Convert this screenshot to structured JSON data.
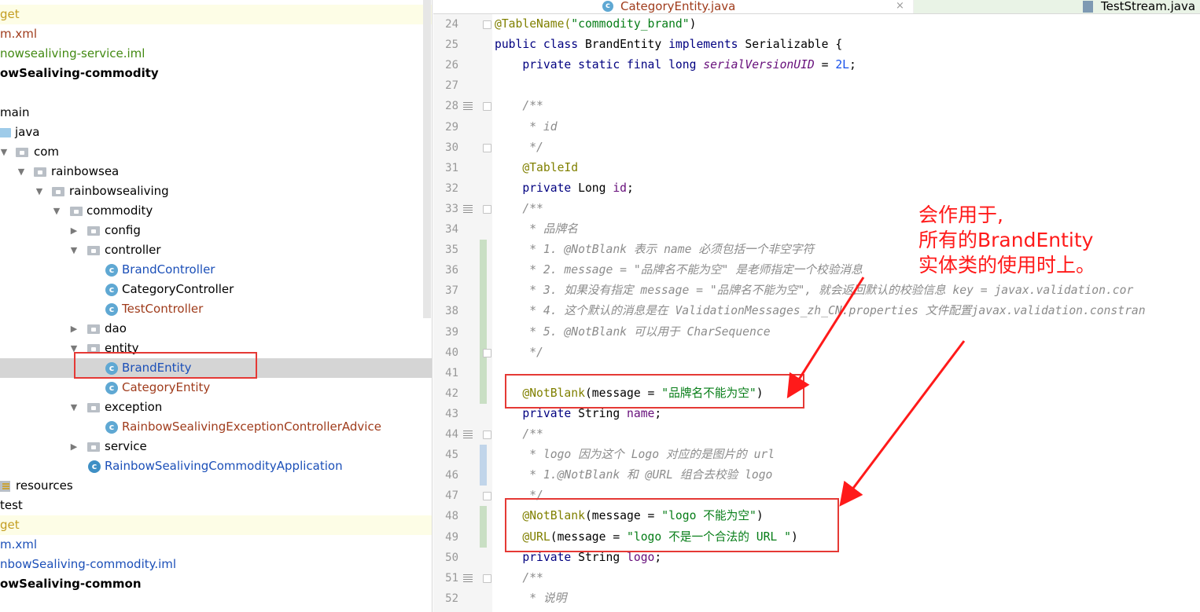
{
  "tree": {
    "rows": [
      {
        "label": "get",
        "color": "#c39d21",
        "bg": "yellow"
      },
      {
        "label": "m.xml",
        "color": "#9f3b1b"
      },
      {
        "label": "nowsealiving-service.iml",
        "color": "#438a13"
      },
      {
        "label": "owSealiving-commodity",
        "color": "#000000",
        "bold": true
      },
      {
        "label": "",
        "color": "#000000"
      },
      {
        "label": "main",
        "color": "#000000"
      },
      {
        "label": "java",
        "color": "#000000"
      },
      {
        "label": "com",
        "color": "#000000"
      },
      {
        "label": "rainbowsea",
        "color": "#000000"
      },
      {
        "label": "rainbowsealiving",
        "color": "#000000"
      },
      {
        "label": "commodity",
        "color": "#000000"
      },
      {
        "label": "config",
        "color": "#000000"
      },
      {
        "label": "controller",
        "color": "#000000"
      },
      {
        "label": "BrandController",
        "color": "#1b4fb8"
      },
      {
        "label": "CategoryController",
        "color": "#000000"
      },
      {
        "label": "TestController",
        "color": "#9f3b1b"
      },
      {
        "label": "dao",
        "color": "#000000"
      },
      {
        "label": "entity",
        "color": "#000000"
      },
      {
        "label": "BrandEntity",
        "color": "#1b4fb8",
        "bg": "sel"
      },
      {
        "label": "CategoryEntity",
        "color": "#9f3b1b"
      },
      {
        "label": "exception",
        "color": "#000000"
      },
      {
        "label": "RainbowSealivingExceptionControllerAdvice",
        "color": "#9f3b1b"
      },
      {
        "label": "service",
        "color": "#000000"
      },
      {
        "label": "RainbowSealivingCommodityApplication",
        "color": "#1b4fb8"
      },
      {
        "label": "resources",
        "color": "#000000"
      },
      {
        "label": "test",
        "color": "#000000"
      },
      {
        "label": "get",
        "color": "#c39d21",
        "bg": "yellow"
      },
      {
        "label": "m.xml",
        "color": "#1b4fb8"
      },
      {
        "label": "nbowSealiving-commodity.iml",
        "color": "#1b4fb8"
      },
      {
        "label": "owSealiving-common",
        "color": "#000000",
        "bold": true
      }
    ]
  },
  "tabs": {
    "active": "CategoryEntity.java",
    "close": "×",
    "other": "TestStream.java"
  },
  "editor": {
    "lines": [
      {
        "n": "24",
        "segs": [
          [
            "ann",
            "@TableName("
          ],
          [
            "str",
            "\"commodity_brand\""
          ],
          [
            "",
            ")"
          ]
        ]
      },
      {
        "n": "25",
        "segs": [
          [
            "kw",
            "public class "
          ],
          [
            "",
            "BrandEntity "
          ],
          [
            "kw",
            "implements "
          ],
          [
            "",
            "Serializable {"
          ]
        ]
      },
      {
        "n": "26",
        "segs": [
          [
            "",
            "    "
          ],
          [
            "kw",
            "private static final long "
          ],
          [
            "sfld",
            "serialVersionUID"
          ],
          [
            "",
            " = "
          ],
          [
            "num",
            "2L"
          ],
          [
            "",
            ";"
          ]
        ]
      },
      {
        "n": "27",
        "segs": []
      },
      {
        "n": "28",
        "segs": [
          [
            "cmt",
            "    /**"
          ]
        ]
      },
      {
        "n": "29",
        "segs": [
          [
            "cmt",
            "     * id"
          ]
        ]
      },
      {
        "n": "30",
        "segs": [
          [
            "cmt",
            "     */"
          ]
        ]
      },
      {
        "n": "31",
        "segs": [
          [
            "ann",
            "    @TableId"
          ]
        ]
      },
      {
        "n": "32",
        "segs": [
          [
            "kw",
            "    private "
          ],
          [
            "",
            "Long "
          ],
          [
            "fld",
            "id"
          ],
          [
            "",
            ";"
          ]
        ]
      },
      {
        "n": "33",
        "segs": [
          [
            "cmt",
            "    /**"
          ]
        ]
      },
      {
        "n": "34",
        "segs": [
          [
            "cmt",
            "     * 品牌名"
          ]
        ]
      },
      {
        "n": "35",
        "segs": [
          [
            "cmt",
            "     * 1. @NotBlank 表示 name 必须包括一个非空字符"
          ]
        ]
      },
      {
        "n": "36",
        "segs": [
          [
            "cmt",
            "     * 2. message = \"品牌名不能为空\" 是老师指定一个校验消息"
          ]
        ]
      },
      {
        "n": "37",
        "segs": [
          [
            "cmt",
            "     * 3. 如果没有指定 message = \"品牌名不能为空\", 就会返回默认的校验信息 key = javax.validation.cor"
          ]
        ]
      },
      {
        "n": "38",
        "segs": [
          [
            "cmt",
            "     * 4. 这个默认的消息是在 ValidationMessages_zh_CN.properties 文件配置javax.validation.constran"
          ]
        ]
      },
      {
        "n": "39",
        "segs": [
          [
            "cmt",
            "     * 5. @NotBlank 可以用于 CharSequence"
          ]
        ]
      },
      {
        "n": "40",
        "segs": [
          [
            "cmt",
            "     */"
          ]
        ]
      },
      {
        "n": "41",
        "segs": []
      },
      {
        "n": "42",
        "segs": [
          [
            "ann",
            "    @NotBlank"
          ],
          [
            "",
            "(message = "
          ],
          [
            "str",
            "\"品牌名不能为空\""
          ],
          [
            "",
            ")"
          ]
        ]
      },
      {
        "n": "43",
        "segs": [
          [
            "kw",
            "    private "
          ],
          [
            "",
            "String "
          ],
          [
            "fld",
            "name"
          ],
          [
            "",
            ";"
          ]
        ]
      },
      {
        "n": "44",
        "segs": [
          [
            "cmt",
            "    /**"
          ]
        ]
      },
      {
        "n": "45",
        "segs": [
          [
            "cmt",
            "     * logo 因为这个 Logo 对应的是图片的 url"
          ]
        ]
      },
      {
        "n": "46",
        "segs": [
          [
            "cmt",
            "     * 1.@NotBlank 和 @URL 组合去校验 logo"
          ]
        ]
      },
      {
        "n": "47",
        "segs": [
          [
            "cmt",
            "     */"
          ]
        ]
      },
      {
        "n": "48",
        "segs": [
          [
            "ann",
            "    @NotBlank"
          ],
          [
            "",
            "(message = "
          ],
          [
            "str",
            "\"logo 不能为空\""
          ],
          [
            "",
            ")"
          ]
        ]
      },
      {
        "n": "49",
        "segs": [
          [
            "ann",
            "    @URL"
          ],
          [
            "",
            "(message = "
          ],
          [
            "str",
            "\"logo 不是一个合法的 URL \""
          ],
          [
            "",
            ")"
          ]
        ]
      },
      {
        "n": "50",
        "segs": [
          [
            "kw",
            "    private "
          ],
          [
            "",
            "String "
          ],
          [
            "fld",
            "logo"
          ],
          [
            "",
            ";"
          ]
        ]
      },
      {
        "n": "51",
        "segs": [
          [
            "cmt",
            "    /**"
          ]
        ]
      },
      {
        "n": "52",
        "segs": [
          [
            "cmt",
            "     * 说明"
          ]
        ]
      }
    ]
  },
  "annotation": {
    "line1": "会作用于,",
    "line2": "所有的BrandEntity",
    "line3": "实体类的使用时上。",
    "color": "#ff1a1a"
  }
}
